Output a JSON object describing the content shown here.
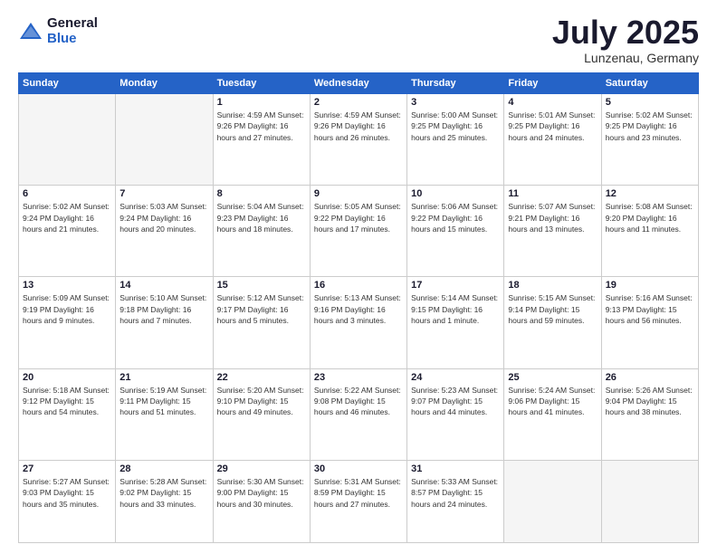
{
  "header": {
    "logo_general": "General",
    "logo_blue": "Blue",
    "title": "July 2025",
    "location": "Lunzenau, Germany"
  },
  "weekdays": [
    "Sunday",
    "Monday",
    "Tuesday",
    "Wednesday",
    "Thursday",
    "Friday",
    "Saturday"
  ],
  "weeks": [
    [
      {
        "day": "",
        "info": ""
      },
      {
        "day": "",
        "info": ""
      },
      {
        "day": "1",
        "info": "Sunrise: 4:59 AM\nSunset: 9:26 PM\nDaylight: 16 hours\nand 27 minutes."
      },
      {
        "day": "2",
        "info": "Sunrise: 4:59 AM\nSunset: 9:26 PM\nDaylight: 16 hours\nand 26 minutes."
      },
      {
        "day": "3",
        "info": "Sunrise: 5:00 AM\nSunset: 9:25 PM\nDaylight: 16 hours\nand 25 minutes."
      },
      {
        "day": "4",
        "info": "Sunrise: 5:01 AM\nSunset: 9:25 PM\nDaylight: 16 hours\nand 24 minutes."
      },
      {
        "day": "5",
        "info": "Sunrise: 5:02 AM\nSunset: 9:25 PM\nDaylight: 16 hours\nand 23 minutes."
      }
    ],
    [
      {
        "day": "6",
        "info": "Sunrise: 5:02 AM\nSunset: 9:24 PM\nDaylight: 16 hours\nand 21 minutes."
      },
      {
        "day": "7",
        "info": "Sunrise: 5:03 AM\nSunset: 9:24 PM\nDaylight: 16 hours\nand 20 minutes."
      },
      {
        "day": "8",
        "info": "Sunrise: 5:04 AM\nSunset: 9:23 PM\nDaylight: 16 hours\nand 18 minutes."
      },
      {
        "day": "9",
        "info": "Sunrise: 5:05 AM\nSunset: 9:22 PM\nDaylight: 16 hours\nand 17 minutes."
      },
      {
        "day": "10",
        "info": "Sunrise: 5:06 AM\nSunset: 9:22 PM\nDaylight: 16 hours\nand 15 minutes."
      },
      {
        "day": "11",
        "info": "Sunrise: 5:07 AM\nSunset: 9:21 PM\nDaylight: 16 hours\nand 13 minutes."
      },
      {
        "day": "12",
        "info": "Sunrise: 5:08 AM\nSunset: 9:20 PM\nDaylight: 16 hours\nand 11 minutes."
      }
    ],
    [
      {
        "day": "13",
        "info": "Sunrise: 5:09 AM\nSunset: 9:19 PM\nDaylight: 16 hours\nand 9 minutes."
      },
      {
        "day": "14",
        "info": "Sunrise: 5:10 AM\nSunset: 9:18 PM\nDaylight: 16 hours\nand 7 minutes."
      },
      {
        "day": "15",
        "info": "Sunrise: 5:12 AM\nSunset: 9:17 PM\nDaylight: 16 hours\nand 5 minutes."
      },
      {
        "day": "16",
        "info": "Sunrise: 5:13 AM\nSunset: 9:16 PM\nDaylight: 16 hours\nand 3 minutes."
      },
      {
        "day": "17",
        "info": "Sunrise: 5:14 AM\nSunset: 9:15 PM\nDaylight: 16 hours\nand 1 minute."
      },
      {
        "day": "18",
        "info": "Sunrise: 5:15 AM\nSunset: 9:14 PM\nDaylight: 15 hours\nand 59 minutes."
      },
      {
        "day": "19",
        "info": "Sunrise: 5:16 AM\nSunset: 9:13 PM\nDaylight: 15 hours\nand 56 minutes."
      }
    ],
    [
      {
        "day": "20",
        "info": "Sunrise: 5:18 AM\nSunset: 9:12 PM\nDaylight: 15 hours\nand 54 minutes."
      },
      {
        "day": "21",
        "info": "Sunrise: 5:19 AM\nSunset: 9:11 PM\nDaylight: 15 hours\nand 51 minutes."
      },
      {
        "day": "22",
        "info": "Sunrise: 5:20 AM\nSunset: 9:10 PM\nDaylight: 15 hours\nand 49 minutes."
      },
      {
        "day": "23",
        "info": "Sunrise: 5:22 AM\nSunset: 9:08 PM\nDaylight: 15 hours\nand 46 minutes."
      },
      {
        "day": "24",
        "info": "Sunrise: 5:23 AM\nSunset: 9:07 PM\nDaylight: 15 hours\nand 44 minutes."
      },
      {
        "day": "25",
        "info": "Sunrise: 5:24 AM\nSunset: 9:06 PM\nDaylight: 15 hours\nand 41 minutes."
      },
      {
        "day": "26",
        "info": "Sunrise: 5:26 AM\nSunset: 9:04 PM\nDaylight: 15 hours\nand 38 minutes."
      }
    ],
    [
      {
        "day": "27",
        "info": "Sunrise: 5:27 AM\nSunset: 9:03 PM\nDaylight: 15 hours\nand 35 minutes."
      },
      {
        "day": "28",
        "info": "Sunrise: 5:28 AM\nSunset: 9:02 PM\nDaylight: 15 hours\nand 33 minutes."
      },
      {
        "day": "29",
        "info": "Sunrise: 5:30 AM\nSunset: 9:00 PM\nDaylight: 15 hours\nand 30 minutes."
      },
      {
        "day": "30",
        "info": "Sunrise: 5:31 AM\nSunset: 8:59 PM\nDaylight: 15 hours\nand 27 minutes."
      },
      {
        "day": "31",
        "info": "Sunrise: 5:33 AM\nSunset: 8:57 PM\nDaylight: 15 hours\nand 24 minutes."
      },
      {
        "day": "",
        "info": ""
      },
      {
        "day": "",
        "info": ""
      }
    ]
  ]
}
